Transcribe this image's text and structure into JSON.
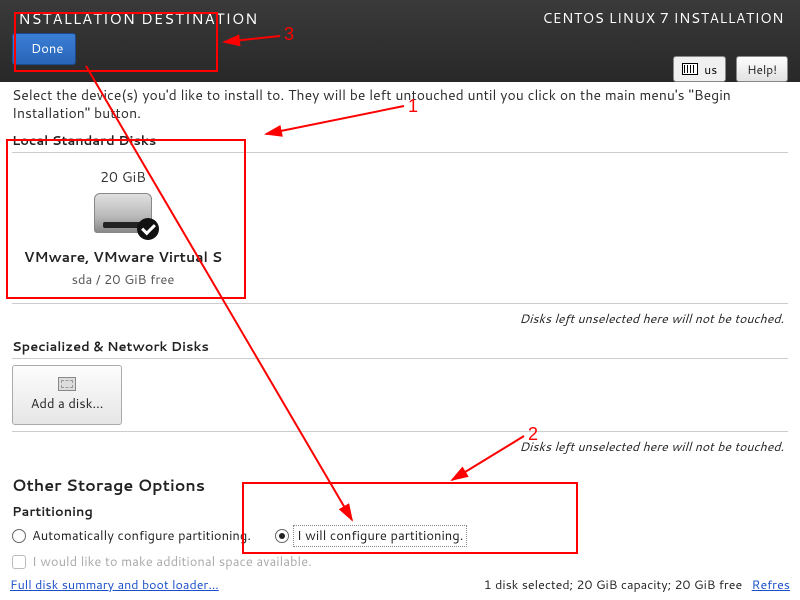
{
  "header": {
    "page_title": "INSTALLATION DESTINATION",
    "done_label": "Done",
    "product_title": "CENTOS LINUX 7 INSTALLATION",
    "keyboard_layout": "us",
    "help_label": "Help!"
  },
  "instruction": "Select the device(s) you'd like to install to.  They will be left untouched until you click on the main menu's \"Begin Installation\" button.",
  "local_disks": {
    "section_label": "Local Standard Disks",
    "note": "Disks left unselected here will not be touched.",
    "items": [
      {
        "size": "20 GiB",
        "name": "VMware, VMware Virtual S",
        "detail": "sda    /    20 GiB free",
        "selected": true
      }
    ]
  },
  "network_disks": {
    "section_label": "Specialized & Network Disks",
    "add_label": "Add a disk...",
    "note": "Disks left unselected here will not be touched."
  },
  "other_storage": {
    "title": "Other Storage Options",
    "partitioning_label": "Partitioning",
    "auto_label": "Automatically configure partitioning.",
    "manual_label": "I will configure partitioning.",
    "manual_selected": true,
    "additional_space_label": "I would like to make additional space available."
  },
  "footer": {
    "summary_link": "Full disk summary and boot loader...",
    "status": "1 disk selected; 20 GiB capacity; 20 GiB free",
    "refresh_label": "Refres"
  },
  "annotations": {
    "l1": "1",
    "l2": "2",
    "l3": "3"
  }
}
